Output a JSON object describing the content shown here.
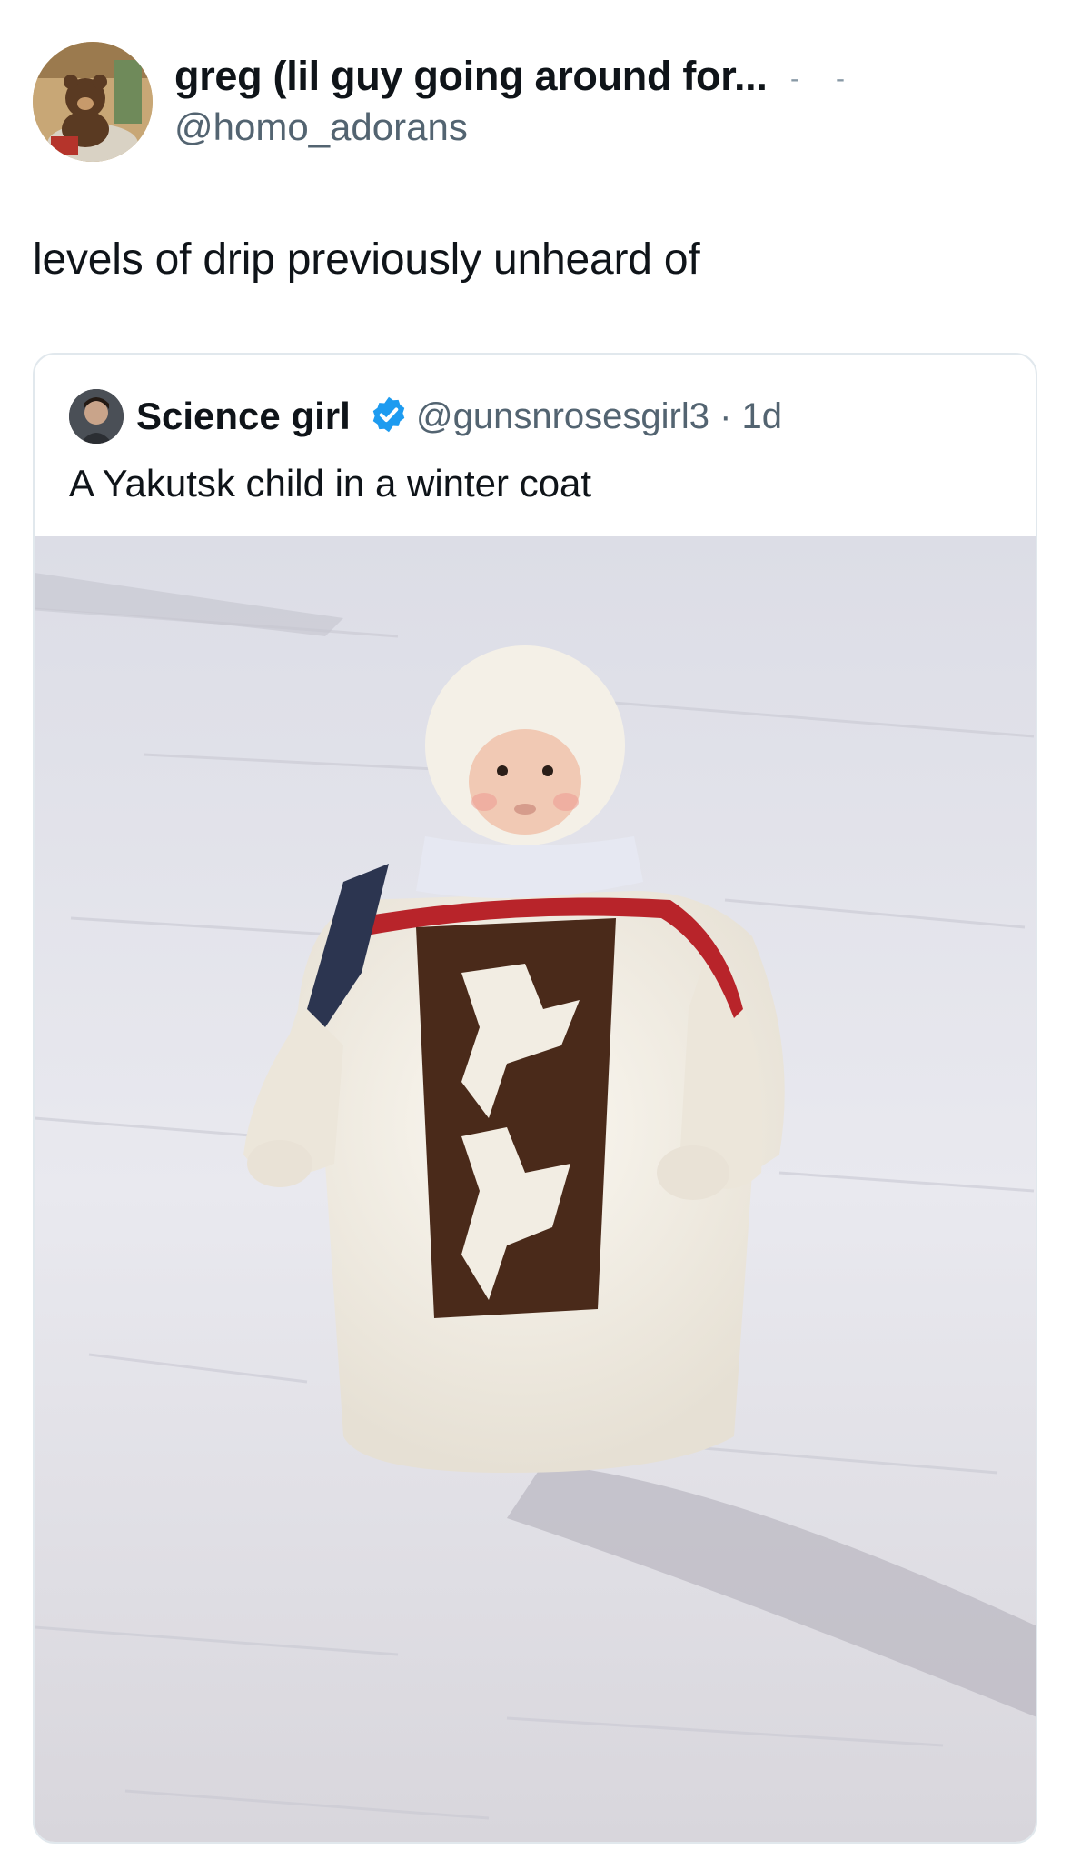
{
  "tweet": {
    "author_name": "greg (lil guy going around for...",
    "author_handle": "@homo_adorans",
    "text": "levels of drip previously unheard of",
    "avatar_icon": "bear-avatar-icon"
  },
  "quoted_tweet": {
    "author_name": "Science girl",
    "verified_icon": "verified-badge-icon",
    "author_handle_time": "@gunsnrosesgirl3 · 1d",
    "text": "A Yakutsk child in a winter coat",
    "avatar_icon": "person-avatar-icon"
  },
  "colors": {
    "text_primary": "#0f1419",
    "text_secondary": "#536471",
    "verified_blue": "#1d9bf0",
    "card_border": "#e1e8ed"
  }
}
